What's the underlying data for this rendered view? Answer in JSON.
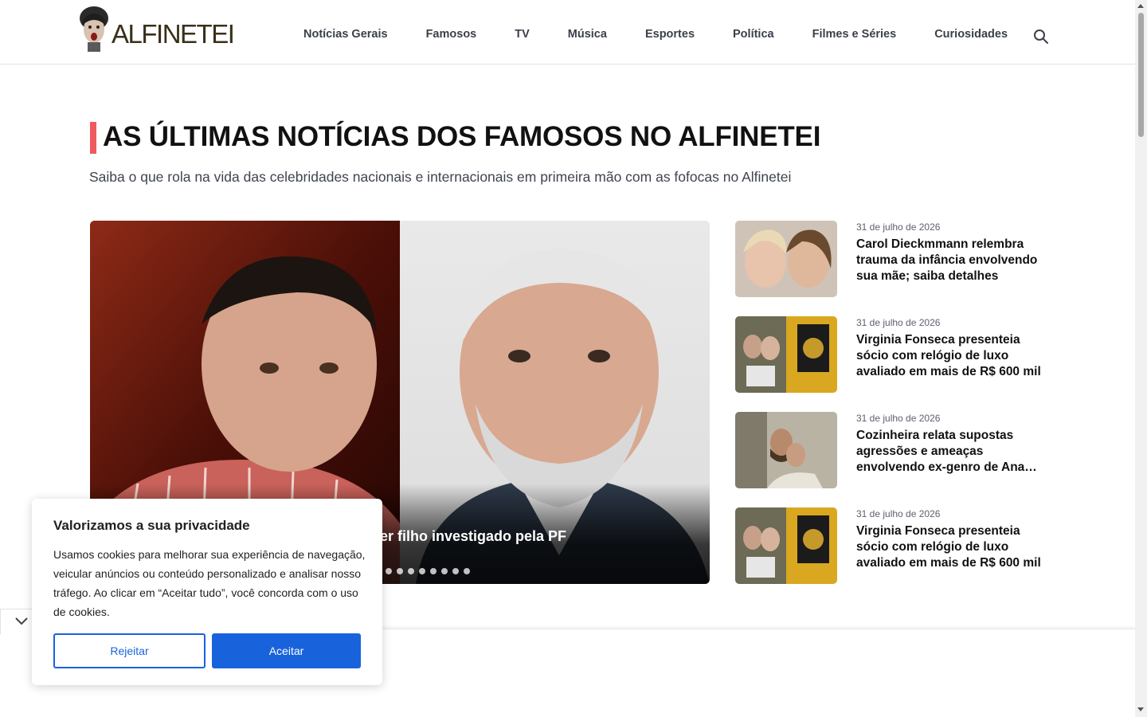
{
  "header": {
    "logo_text": "ALFINETEI",
    "nav": [
      "Notícias Gerais",
      "Famosos",
      "TV",
      "Música",
      "Esportes",
      "Política",
      "Filmes e Séries",
      "Curiosidades"
    ]
  },
  "page": {
    "title": "AS ÚLTIMAS NOTÍCIAS DOS FAMOSOS NO ALFINETEI",
    "subtitle": "Saiba o que rola na vida das celebridades nacionais e internacionais em primeira mão com as fofocas no Alfinetei"
  },
  "hero": {
    "visible_title": "er filho investigado pela PF",
    "dot_count": 8
  },
  "side_news": [
    {
      "date": "31 de julho de 2026",
      "title": "Carol Dieckmmann relembra trauma da infância envolvendo sua mãe; saiba detalhes"
    },
    {
      "date": "31 de julho de 2026",
      "title": "Virginia Fonseca presenteia sócio com relógio de luxo avaliado em mais de R$ 600 mil"
    },
    {
      "date": "31 de julho de 2026",
      "title": "Cozinheira relata supostas agressões e ameaças envolvendo ex-genro de Ana…"
    },
    {
      "date": "31 de julho de 2026",
      "title": "Virginia Fonseca presenteia sócio com relógio de luxo avaliado em mais de R$ 600 mil"
    }
  ],
  "cookie": {
    "title": "Valorizamos a sua privacidade",
    "text": "Usamos cookies para melhorar sua experiência de navegação, veicular anúncios ou conteúdo personalizado e analisar nosso tráfego. Ao clicar em “Aceitar tudo”, você concorda com o uso de cookies.",
    "reject_label": "Rejeitar",
    "accept_label": "Aceitar"
  },
  "colors": {
    "accent_red": "#ee5a5f",
    "primary_blue": "#1863dc"
  },
  "icons": [
    "search-icon",
    "chevron-down-icon"
  ]
}
